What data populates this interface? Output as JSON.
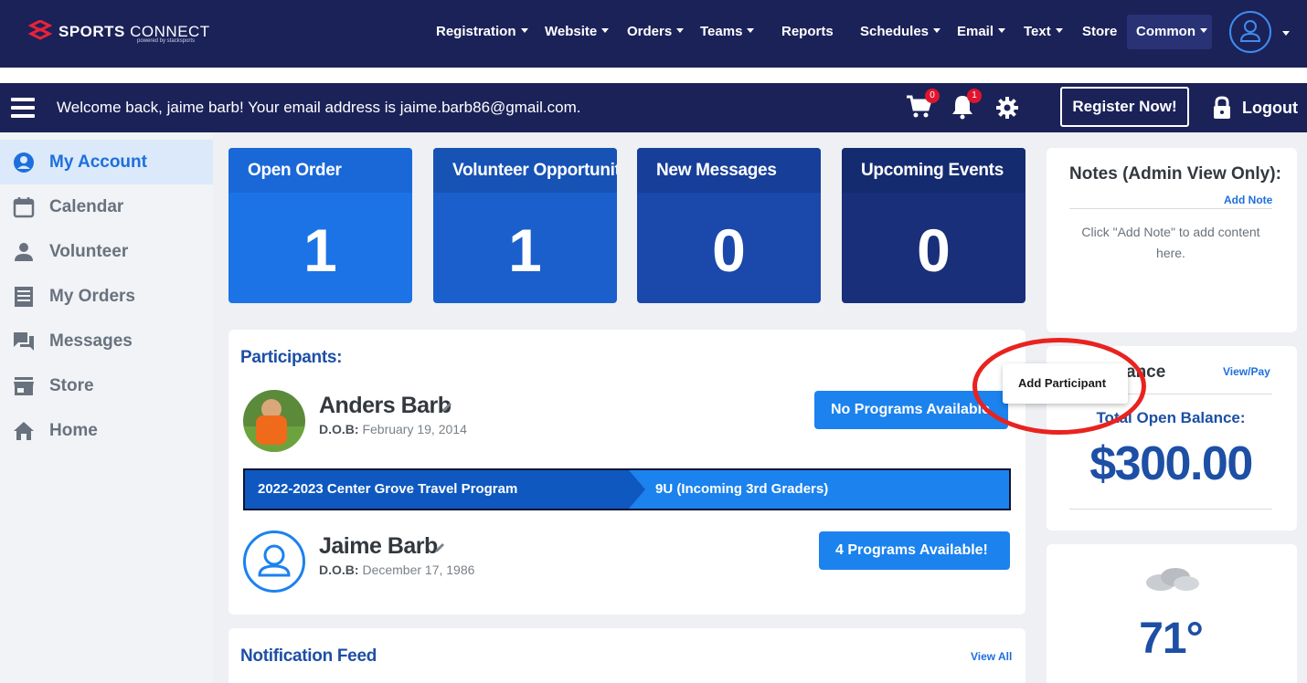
{
  "app": {
    "logo_main": "SPORTS",
    "logo_light": "CONNECT",
    "logo_sub": "powered by stacksports"
  },
  "topnav": {
    "items": [
      "Registration",
      "Website",
      "Orders",
      "Teams",
      "Reports",
      "Schedules",
      "Email",
      "Text",
      "Store",
      "Common"
    ]
  },
  "secbar": {
    "welcome": "Welcome back, jaime barb! Your email address is jaime.barb86@gmail.com.",
    "cart_count": "0",
    "notif_count": "1",
    "register_label": "Register Now!",
    "logout_label": "Logout"
  },
  "sidebar": {
    "items": [
      {
        "label": "My Account",
        "icon": "account-circle-icon"
      },
      {
        "label": "Calendar",
        "icon": "calendar-icon"
      },
      {
        "label": "Volunteer",
        "icon": "person-icon"
      },
      {
        "label": "My Orders",
        "icon": "list-icon"
      },
      {
        "label": "Messages",
        "icon": "chat-icon"
      },
      {
        "label": "Store",
        "icon": "store-icon"
      },
      {
        "label": "Home",
        "icon": "home-icon"
      }
    ]
  },
  "stats": [
    {
      "title": "Open Order",
      "value": "1",
      "head_color": "#1a68d8",
      "body_color": "#1c73e6"
    },
    {
      "title": "Volunteer Opportunity",
      "value": "1",
      "head_color": "#1752b5",
      "body_color": "#1a5fcb"
    },
    {
      "title": "New Messages",
      "value": "0",
      "head_color": "#173e99",
      "body_color": "#1a48ab"
    },
    {
      "title": "Upcoming Events",
      "value": "0",
      "head_color": "#152b6f",
      "body_color": "#192f79"
    }
  ],
  "participants": {
    "title": "Participants:",
    "menu_item": "Add Participant",
    "people": [
      {
        "name": "Anders Barb",
        "dob_label": "D.O.B:",
        "dob": "February 19, 2014",
        "button": "No Programs Available"
      },
      {
        "name": "Jaime Barb",
        "dob_label": "D.O.B:",
        "dob": "December 17, 1986",
        "button": "4 Programs Available!"
      }
    ],
    "program": {
      "name": "2022-2023 Center Grove Travel Program",
      "division": "9U (Incoming 3rd Graders)"
    }
  },
  "notification_feed": {
    "title": "Notification Feed",
    "view_all": "View All"
  },
  "notes": {
    "title": "Notes (Admin View Only):",
    "add_note": "Add Note",
    "empty": "Click \"Add Note\" to add content here."
  },
  "balance": {
    "title_visible": "ance",
    "view_pay": "View/Pay",
    "label_visible": "Total Open Balance:",
    "amount": "$300.00"
  },
  "weather": {
    "temp": "71°"
  }
}
